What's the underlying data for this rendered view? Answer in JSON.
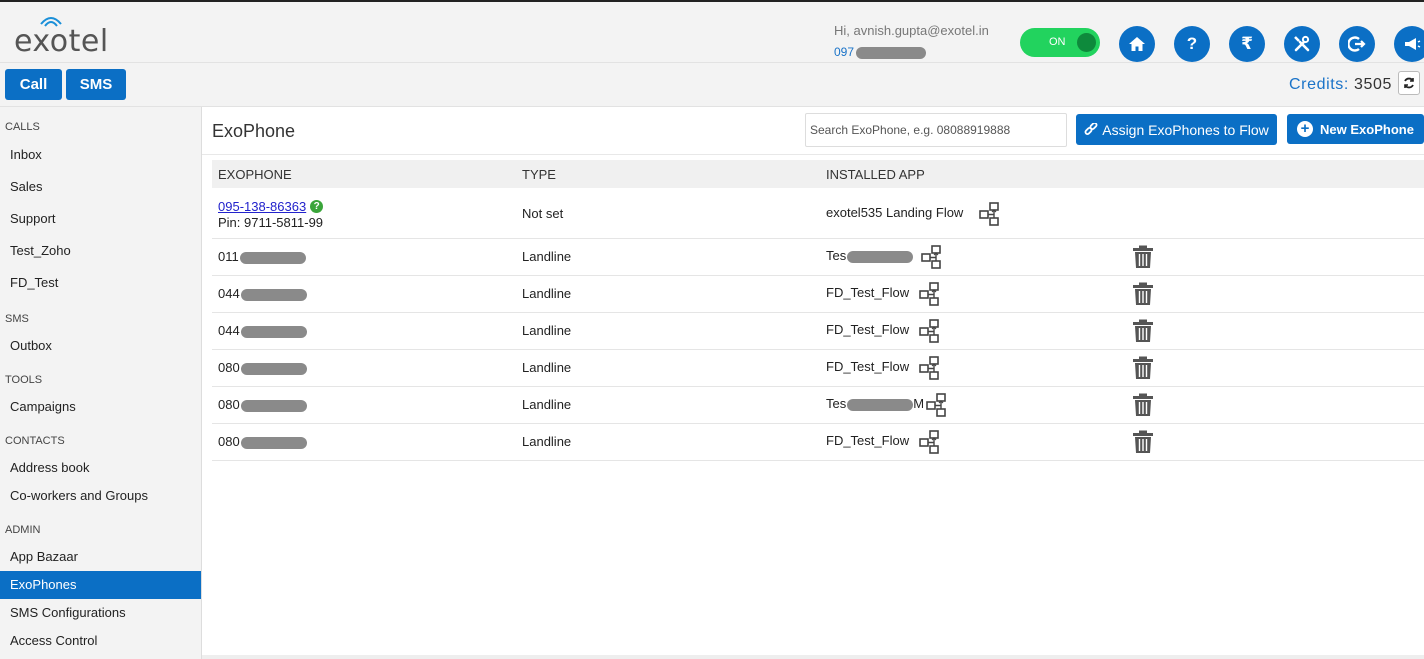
{
  "header": {
    "logo_text": "exotel",
    "greeting": "Hi, avnish.gupta@exotel.in",
    "phone_prefix": "097",
    "toggle_label": "ON",
    "icons": [
      "home-icon",
      "help-icon",
      "rupee-icon",
      "tools-icon",
      "logout-icon",
      "announce-icon"
    ],
    "icon_glyphs": {
      "help": "?",
      "rupee": "₹"
    }
  },
  "actionbar": {
    "call_label": "Call",
    "sms_label": "SMS",
    "credits_label": "Credits:",
    "credits_value": "3505"
  },
  "sidebar": {
    "sections": [
      {
        "title": "CALLS",
        "items": [
          "Inbox",
          "Sales",
          "Support",
          "Test_Zoho",
          "FD_Test"
        ]
      },
      {
        "title": "SMS",
        "items": [
          "Outbox"
        ]
      },
      {
        "title": "TOOLS",
        "items": [
          "Campaigns"
        ]
      },
      {
        "title": "CONTACTS",
        "items": [
          "Address book",
          "Co-workers and Groups"
        ]
      },
      {
        "title": "ADMIN",
        "items": [
          "App Bazaar",
          "ExoPhones",
          "SMS Configurations",
          "Access Control"
        ]
      }
    ],
    "active_item": "ExoPhones"
  },
  "main": {
    "title": "ExoPhone",
    "search_placeholder": "Search ExoPhone, e.g. 08088919888",
    "assign_label": "Assign ExoPhones to Flow",
    "new_label": "New ExoPhone",
    "columns": [
      "EXOPHONE",
      "TYPE",
      "INSTALLED APP"
    ],
    "rows": [
      {
        "number": "095-138-86363",
        "pin": "Pin: 9711-5811-99",
        "type": "Not set",
        "app": "exotel535 Landing Flow",
        "deletable": false
      },
      {
        "number": "011",
        "type": "Landline",
        "app": "Tes",
        "deletable": true
      },
      {
        "number": "044",
        "type": "Landline",
        "app": "FD_Test_Flow",
        "deletable": true
      },
      {
        "number": "044",
        "type": "Landline",
        "app": "FD_Test_Flow",
        "deletable": true
      },
      {
        "number": "080",
        "type": "Landline",
        "app": "FD_Test_Flow",
        "deletable": true
      },
      {
        "number": "080",
        "type": "Landline",
        "app": "Tes",
        "app_suffix": "M",
        "deletable": true
      },
      {
        "number": "080",
        "type": "Landline",
        "app": "FD_Test_Flow",
        "deletable": true
      }
    ]
  },
  "colors": {
    "brand_blue": "#0b6fc5",
    "toggle_green": "#22d35e",
    "link": "#2222cc"
  }
}
